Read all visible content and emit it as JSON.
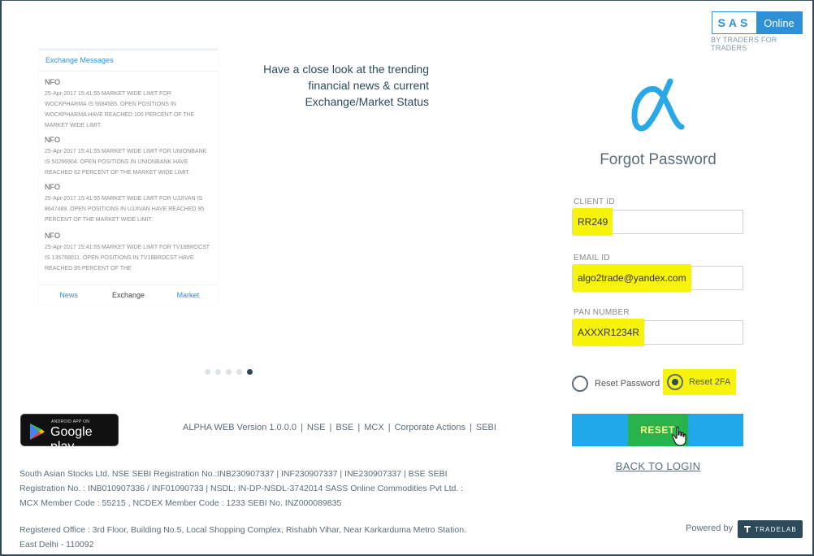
{
  "brand": {
    "sas": "SAS",
    "online": "Online",
    "tagline": "BY TRADERS FOR TRADERS",
    "accent": "#2e90d6"
  },
  "panel": {
    "header": "Exchange Messages",
    "messages": [
      {
        "segment": "NFO",
        "text": "25-Apr-2017 15:41:55 MARKET WIDE LIMIT FOR WOCKPHARMA IS 5684585. OPEN POSITIONS IN WOCKPHARMA HAVE REACHED 100 PERCENT OF THE MARKET WIDE LIMIT."
      },
      {
        "segment": "NFO",
        "text": "25-Apr-2017 15:41:55 MARKET WIDE LIMIT FOR UNIONBANK IS 50266904. OPEN POSITIONS IN UNIONBANK HAVE REACHED 62 PERCENT OF THE MARKET WIDE LIMIT."
      },
      {
        "segment": "NFO",
        "text": "25-Apr-2017 15:41:55 MARKET WIDE LIMIT FOR UJJIVAN IS 8647489. OPEN POSITIONS IN UJJIVAN HAVE REACHED 95 PERCENT OF THE MARKET WIDE LIMIT."
      },
      {
        "segment": "NFO",
        "text": "25-Apr-2017 15:41:55 MARKET WIDE LIMIT FOR TV18BRDCST IS 135768011. OPEN POSITIONS IN TV18BRDCST HAVE REACHED 95 PERCENT OF THE"
      }
    ],
    "tabs": [
      "News",
      "Exchange",
      "Market"
    ],
    "active_tab": "Exchange"
  },
  "promo": {
    "line1": "Have a close look at the trending",
    "line2": "financial news & current",
    "line3": "Exchange/Market Status"
  },
  "carousel": {
    "count": 5,
    "active": 5
  },
  "form": {
    "title": "Forgot Password",
    "client_id_label": "CLIENT ID",
    "client_id_value": "RR249",
    "email_label": "EMAIL ID",
    "email_value": "algo2trade@yandex.com",
    "pan_label": "PAN NUMBER",
    "pan_value": "AXXXR1234R",
    "option1": "Reset Password",
    "option2": "Reset 2FA",
    "selected_option": "Reset 2FA",
    "reset_label": "RESET",
    "back_label": "BACK TO LOGIN",
    "highlight_color": "#f7f40a",
    "button_color": "#1fa9e8"
  },
  "footer": {
    "gplay_small": "ANDROID APP ON",
    "gplay_big": "Google play",
    "version": "ALPHA WEB Version 1.0.0.0",
    "links": [
      "NSE",
      "BSE",
      "MCX",
      "Corporate Actions",
      "SEBI"
    ],
    "reg1": "South Asian Stocks Ltd. NSE SEBI Registration No.:INB230907337 | INF230907337 | INE230907337 | BSE SEBI",
    "reg2": "Registration No. : INB010907336 / INF01090733 | NSDL: IN-DP-NSDL-3742014 SASS Online Commodities Pvt Ltd. :",
    "reg3": "MCX Member Code : 55215 , NCDEX Member Code : 1233 SEBI No. INZ000089835",
    "office1": "Registered Office : 3rd Floor, Building No.5, Local Shopping Complex, Rishabh Vihar, Near Karkarduma Metro Station.",
    "office2": "East Delhi - 110092",
    "powered": "Powered by",
    "tradelab": "TRADELAB"
  }
}
